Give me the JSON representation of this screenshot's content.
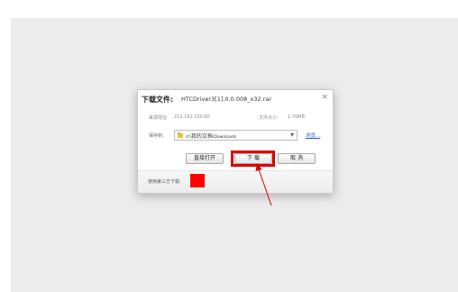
{
  "dialog": {
    "title_label": "下载文件:",
    "file_name": "HTCDriver3[1].0.0.008_x32.rar",
    "close_glyph": "×",
    "source_label": "来源地址:",
    "source_value": "211.161.150.60",
    "size_label": "文件大小:",
    "size_value": "1.70MB",
    "save_label": "保存到:",
    "path_prefix": "d:\\",
    "path_main": "我的文档",
    "path_suffix": "\\Downloads",
    "path_dropdown_glyph": "▼",
    "browse_label": "浏览...",
    "open_button": "直接打开",
    "download_button": "下  载",
    "cancel_button": "取  消",
    "third_party_label": "使用第三方下载:"
  },
  "colors": {
    "highlight": "#e00000",
    "swatch": "#ff0000",
    "link": "#2a5db0",
    "folder": "#f1c232"
  },
  "icons": {
    "close": "close-icon",
    "folder": "folder-icon",
    "dropdown": "chevron-down-icon"
  }
}
